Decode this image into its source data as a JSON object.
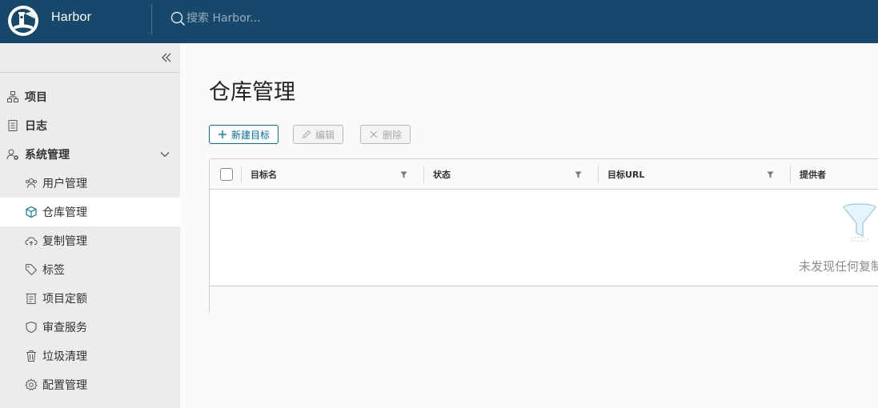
{
  "header": {
    "app_title": "Harbor",
    "search_placeholder": "搜索 Harbor..."
  },
  "sidebar": {
    "items": [
      {
        "label": "项目",
        "icon": "project-icon",
        "level": "top"
      },
      {
        "label": "日志",
        "icon": "log-icon",
        "level": "top"
      },
      {
        "label": "系统管理",
        "icon": "system-admin-icon",
        "level": "top",
        "expanded": true
      },
      {
        "label": "用户管理",
        "icon": "users-icon",
        "level": "sub"
      },
      {
        "label": "仓库管理",
        "icon": "registry-box-icon",
        "level": "sub",
        "active": true
      },
      {
        "label": "复制管理",
        "icon": "cloud-replication-icon",
        "level": "sub"
      },
      {
        "label": "标签",
        "icon": "tag-icon",
        "level": "sub"
      },
      {
        "label": "项目定额",
        "icon": "quota-icon",
        "level": "sub"
      },
      {
        "label": "审查服务",
        "icon": "shield-icon",
        "level": "sub"
      },
      {
        "label": "垃圾清理",
        "icon": "trash-icon",
        "level": "sub"
      },
      {
        "label": "配置管理",
        "icon": "gear-icon",
        "level": "sub"
      }
    ]
  },
  "main": {
    "title": "仓库管理",
    "toolbar": {
      "new_label": "新建目标",
      "edit_label": "编辑",
      "delete_label": "删除"
    },
    "table": {
      "columns": [
        "目标名",
        "状态",
        "目标URL",
        "提供者"
      ],
      "empty_text": "未发现任何复制"
    }
  },
  "colors": {
    "header_bg": "#17476a",
    "sidebar_bg": "#ececec",
    "accent": "#0072a3"
  }
}
